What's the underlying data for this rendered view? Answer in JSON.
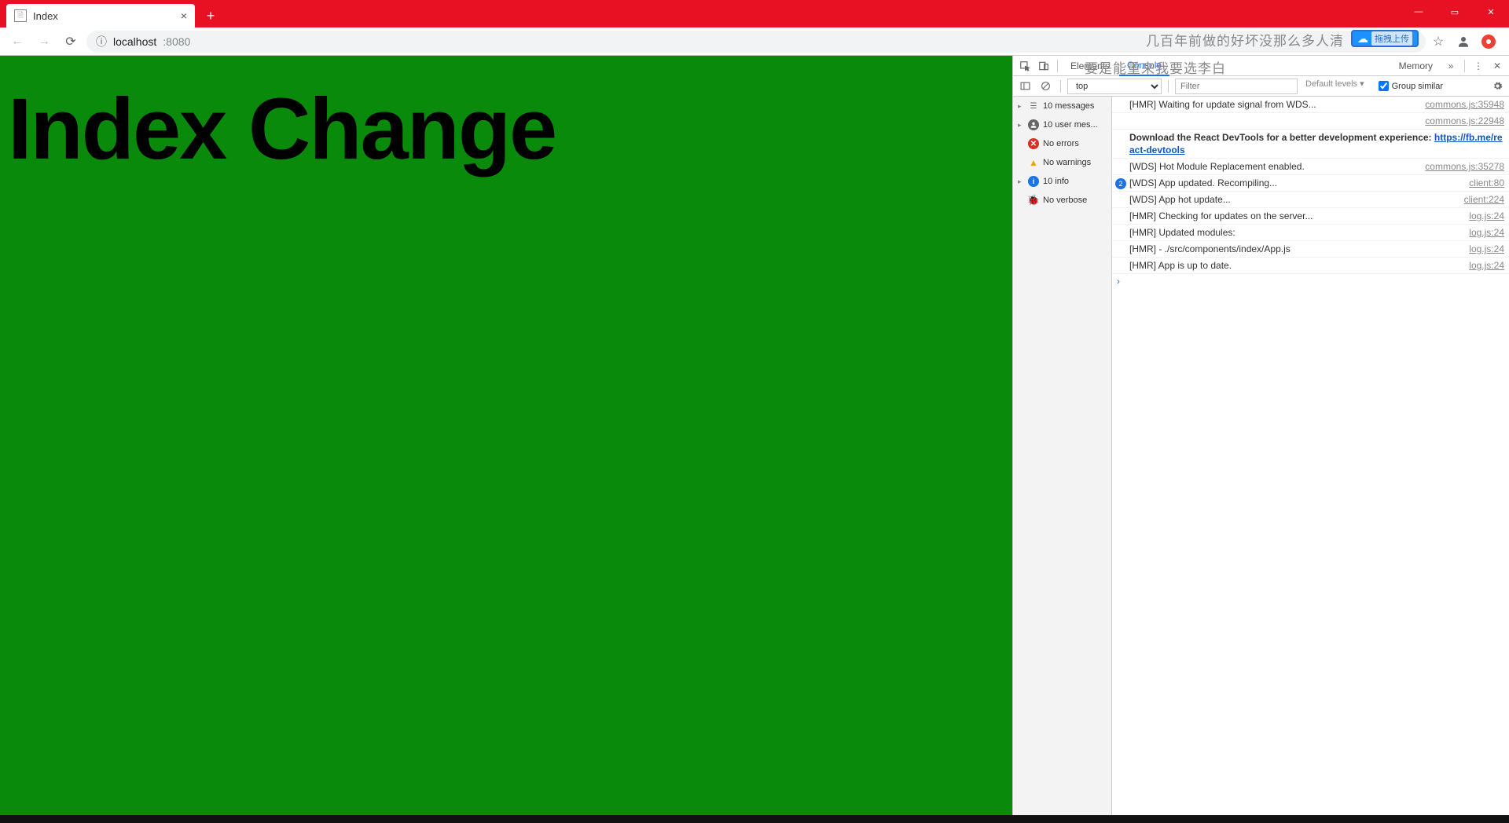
{
  "window": {
    "tab_title": "Index",
    "new_tab": "+",
    "min": "—",
    "max": "▭",
    "close": "✕"
  },
  "address": {
    "info_icon": "ⓘ",
    "host": "localhost",
    "port": ":8080",
    "star": "☆"
  },
  "overlay": {
    "line1": "几百年前做的好坏没那么多人清",
    "line2": "要是能重来我要选李白",
    "ext_label": "拖拽上传"
  },
  "page": {
    "heading": "Index Change"
  },
  "devtools": {
    "tabs": {
      "elements": "Elements",
      "console": "Console",
      "memory": "Memory",
      "more": "»"
    },
    "toolbar": {
      "context": "top",
      "filter_placeholder": "Filter",
      "levels": "Default levels ▾",
      "group_similar": "Group similar"
    },
    "sidebar": {
      "messages": "10 messages",
      "user": "10 user mes...",
      "errors": "No errors",
      "warnings": "No warnings",
      "info": "10 info",
      "verbose": "No verbose"
    },
    "messages": [
      {
        "text": "[HMR] Waiting for update signal from WDS...",
        "src": "commons.js:35948",
        "bold": false,
        "badge": ""
      },
      {
        "text": "",
        "src": "commons.js:22948",
        "bold": false,
        "badge": ""
      },
      {
        "text": "Download the React DevTools for a better development experience: https://fb.me/react-devtools",
        "src": "",
        "bold": true,
        "badge": "",
        "hasLink": true,
        "linkText": "https://fb.me/react-devtools"
      },
      {
        "text": "[WDS] Hot Module Replacement enabled.",
        "src": "commons.js:35278",
        "bold": false,
        "badge": ""
      },
      {
        "text": "[WDS] App updated. Recompiling...",
        "src": "client:80",
        "bold": false,
        "badge": "2"
      },
      {
        "text": "[WDS] App hot update...",
        "src": "client:224",
        "bold": false,
        "badge": ""
      },
      {
        "text": "[HMR] Checking for updates on the server...",
        "src": "log.js:24",
        "bold": false,
        "badge": ""
      },
      {
        "text": "[HMR] Updated modules:",
        "src": "log.js:24",
        "bold": false,
        "badge": ""
      },
      {
        "text": "[HMR]  - ./src/components/index/App.js",
        "src": "log.js:24",
        "bold": false,
        "badge": ""
      },
      {
        "text": "[HMR] App is up to date.",
        "src": "log.js:24",
        "bold": false,
        "badge": ""
      }
    ]
  }
}
